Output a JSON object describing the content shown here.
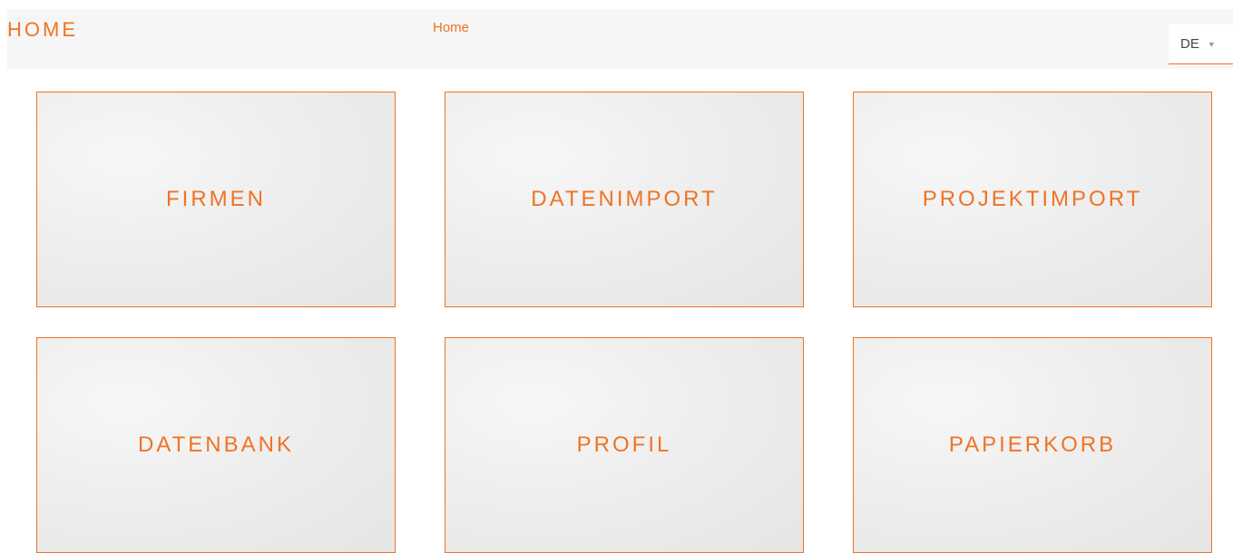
{
  "header": {
    "brand": "HOME",
    "breadcrumb": "Home",
    "language": {
      "selected": "DE",
      "caret_icon": "chevron-down-icon"
    }
  },
  "tiles": [
    {
      "label": "FIRMEN"
    },
    {
      "label": "DATENIMPORT"
    },
    {
      "label": "PROJEKTIMPORT"
    },
    {
      "label": "DATENBANK"
    },
    {
      "label": "PROFIL"
    },
    {
      "label": "PAPIERKORB"
    }
  ],
  "colors": {
    "accent": "#f07324",
    "header_bg": "#f6f6f6",
    "tile_bg": "#eeeeee"
  }
}
